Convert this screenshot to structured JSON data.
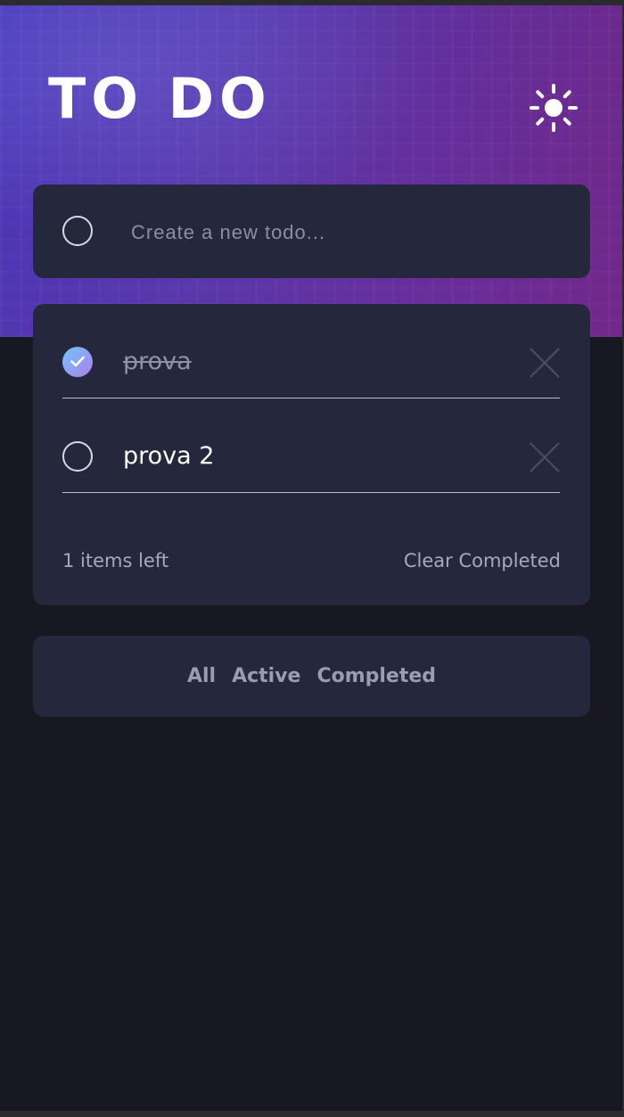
{
  "header": {
    "title": "TO DO",
    "theme_toggle_icon": "sun-icon"
  },
  "new_todo": {
    "placeholder": "Create a new todo...",
    "value": ""
  },
  "todos": [
    {
      "text": "prova",
      "completed": true
    },
    {
      "text": "prova 2",
      "completed": false
    }
  ],
  "footer": {
    "items_left": "1 items left",
    "clear_label": "Clear Completed"
  },
  "filters": {
    "all": "All",
    "active": "Active",
    "completed": "Completed"
  },
  "colors": {
    "background": "#181820",
    "card": "#25273c",
    "hero_start": "#4a3dc4",
    "hero_end": "#7a2b8d",
    "check_start": "#6fc6ff",
    "check_end": "#b07ce8",
    "text_primary": "#ffffff",
    "text_muted": "#9a9cb2"
  }
}
